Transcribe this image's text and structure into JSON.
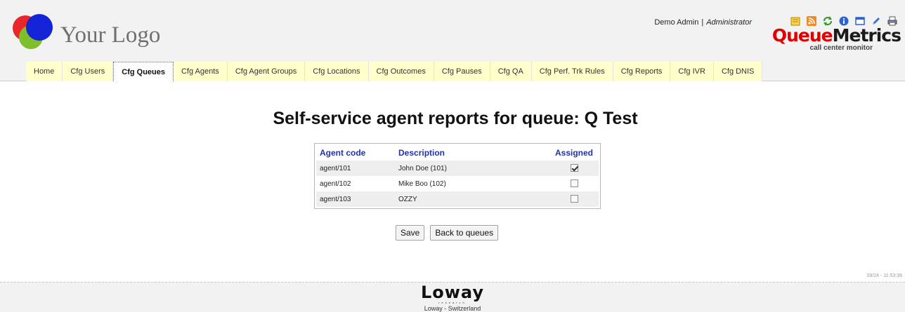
{
  "header": {
    "logo_text": "Your Logo",
    "user_name": "Demo Admin",
    "user_separator": "|",
    "user_role": "Administrator",
    "toolbar_icons": [
      "notes-icon",
      "rss-icon",
      "refresh-icon",
      "info-icon",
      "window-icon",
      "edit-icon",
      "print-icon"
    ],
    "brand_part1": "Queue",
    "brand_part2": "Metrics",
    "brand_tagline": "call center monitor"
  },
  "tabs": [
    {
      "label": "Home"
    },
    {
      "label": "Cfg Users"
    },
    {
      "label": "Cfg Queues",
      "active": true
    },
    {
      "label": "Cfg Agents"
    },
    {
      "label": "Cfg Agent Groups"
    },
    {
      "label": "Cfg Locations"
    },
    {
      "label": "Cfg Outcomes"
    },
    {
      "label": "Cfg Pauses"
    },
    {
      "label": "Cfg QA"
    },
    {
      "label": "Cfg Perf. Trk Rules"
    },
    {
      "label": "Cfg Reports"
    },
    {
      "label": "Cfg IVR"
    },
    {
      "label": "Cfg DNIS"
    }
  ],
  "main": {
    "title": "Self-service agent reports for queue: Q Test",
    "table": {
      "headers": {
        "code": "Agent code",
        "description": "Description",
        "assigned": "Assigned"
      },
      "rows": [
        {
          "code": "agent/101",
          "description": "John Doe (101)",
          "assigned": true
        },
        {
          "code": "agent/102",
          "description": "Mike Boo (102)",
          "assigned": false
        },
        {
          "code": "agent/103",
          "description": "OZZY",
          "assigned": false
        }
      ]
    },
    "save_label": "Save",
    "back_label": "Back to queues",
    "timestamp": "09/24 - 11:53:38"
  },
  "footer": {
    "company": "Loway",
    "company_sub": "research",
    "location": "Loway - Switzerland"
  },
  "colors": {
    "tab_bg": "#ffffcc",
    "header_link": "#2233aa",
    "brand_red": "#e00000"
  }
}
